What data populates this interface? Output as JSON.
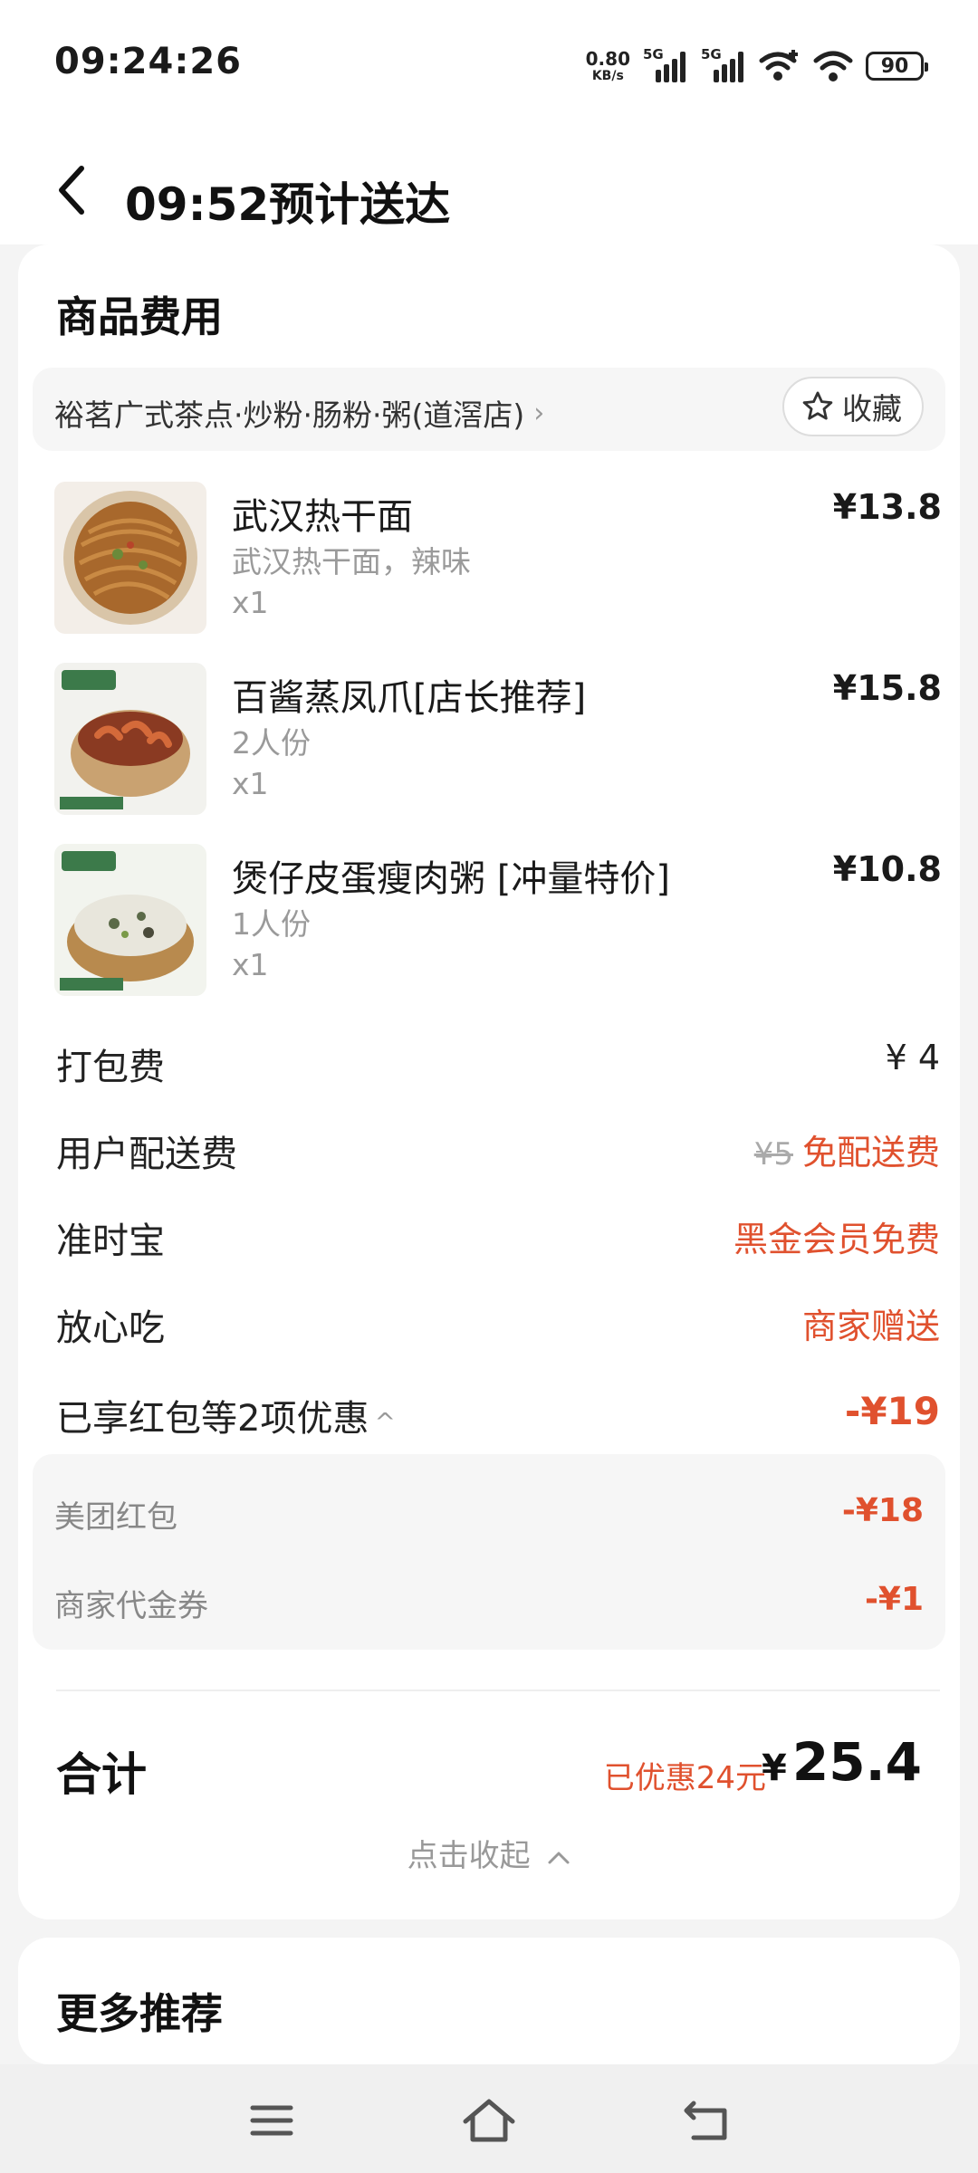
{
  "status_bar": {
    "time": "09:24:26",
    "net_speed_value": "0.80",
    "net_speed_unit": "KB/s",
    "sim1_label": "5G",
    "sim2_label": "5G",
    "battery": "90"
  },
  "header": {
    "title": "09:52预计送达"
  },
  "fees_card": {
    "title": "商品费用",
    "store_name": "裕茗广式茶点·炒粉·肠粉·粥(道滘店)",
    "favorite_label": "收藏",
    "items": [
      {
        "name": "武汉热干面",
        "spec": "武汉热干面，辣味",
        "qty": "x1",
        "price": "¥13.8"
      },
      {
        "name": "百酱蒸凤爪[店长推荐]",
        "spec": "2人份",
        "qty": "x1",
        "price": "¥15.8"
      },
      {
        "name": "煲仔皮蛋瘦肉粥 [冲量特价]",
        "spec": "1人份",
        "qty": "x1",
        "price": "¥10.8"
      }
    ],
    "packing_fee": {
      "label": "打包费",
      "value": "¥ 4"
    },
    "delivery_fee": {
      "label": "用户配送费",
      "original": "¥5",
      "value": "免配送费"
    },
    "on_time": {
      "label": "准时宝",
      "value": "黑金会员免费"
    },
    "safe_eat": {
      "label": "放心吃",
      "value": "商家赠送"
    },
    "discounts_summary": {
      "label": "已享红包等2项优惠",
      "value": "-¥19"
    },
    "discounts": [
      {
        "label": "美团红包",
        "value": "-¥18"
      },
      {
        "label": "商家代金券",
        "value": "-¥1"
      }
    ],
    "total": {
      "label": "合计",
      "saved": "已优惠24元",
      "currency": "¥",
      "amount": "25.4"
    },
    "collapse_label": "点击收起"
  },
  "more_card": {
    "title": "更多推荐"
  },
  "colors": {
    "accent_red": "#e0512e",
    "background": "#f4f4f4",
    "card": "#ffffff"
  }
}
